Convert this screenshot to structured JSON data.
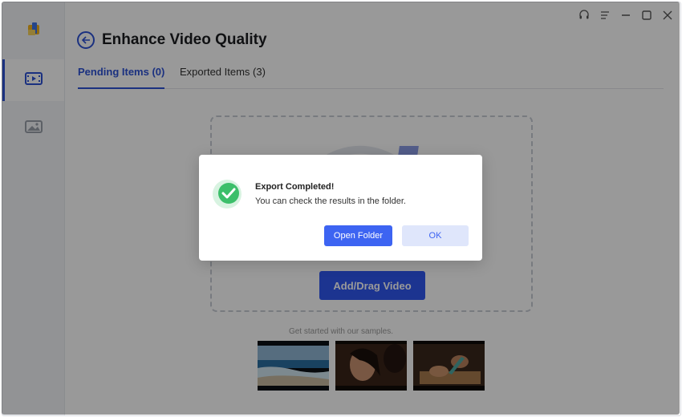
{
  "window": {
    "title": "Enhance Video Quality"
  },
  "window_controls": [
    "headset-icon",
    "menu-icon",
    "minimize-icon",
    "maximize-icon",
    "close-icon"
  ],
  "sidebar": {
    "items": [
      {
        "icon": "app-logo-icon",
        "active": false
      },
      {
        "icon": "video-enhance-icon",
        "active": true
      },
      {
        "icon": "image-enhance-icon",
        "active": false
      }
    ]
  },
  "tabs": [
    {
      "label": "Pending Items (0)",
      "active": true
    },
    {
      "label": "Exported Items (3)",
      "active": false
    }
  ],
  "main": {
    "add_button_label": "Add/Drag Video",
    "samples_label": "Get started with our samples."
  },
  "samples": [
    {
      "name": "beach-waves"
    },
    {
      "name": "portrait-woman"
    },
    {
      "name": "hands-cutting"
    }
  ],
  "dialog": {
    "title": "Export Completed!",
    "message": "You can check the results in the folder.",
    "open_folder_label": "Open Folder",
    "ok_label": "OK"
  },
  "colors": {
    "accent": "#2d52d6",
    "success": "#3cbf6a",
    "button_primary": "#3d64f2"
  }
}
